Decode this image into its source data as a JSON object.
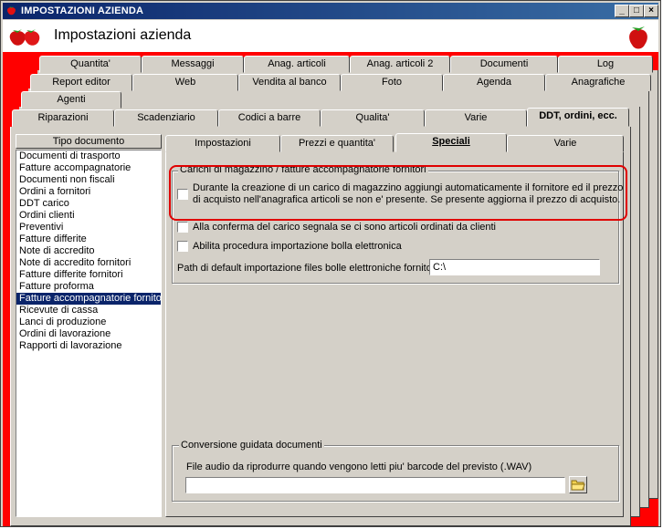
{
  "window": {
    "title": "IMPOSTAZIONI AZIENDA",
    "buttons": {
      "minimize": "_",
      "maximize": "□",
      "close": "×"
    }
  },
  "header": {
    "title": "Impostazioni azienda"
  },
  "tabs": {
    "row1": [
      "Quantita'",
      "Messaggi",
      "Anag. articoli",
      "Anag. articoli 2",
      "Documenti",
      "Log"
    ],
    "row2": [
      "Report editor",
      "Web",
      "Vendita al banco",
      "Foto",
      "Agenda",
      "Anagrafiche"
    ],
    "row3": [
      "Agenti"
    ],
    "row4": [
      "Riparazioni",
      "Scadenziario",
      "Codici a barre",
      "Qualita'",
      "Varie",
      "DDT, ordini, ecc."
    ]
  },
  "doc_list": {
    "header": "Tipo documento",
    "items": [
      "Documenti di trasporto",
      "Fatture accompagnatorie",
      "Documenti non fiscali",
      "Ordini a fornitori",
      "DDT carico",
      "Ordini clienti",
      "Preventivi",
      "Fatture differite",
      "Note di accredito",
      "Note di accredito fornitori",
      "Fatture differite fornitori",
      "Fatture proforma",
      "Fatture accompagnatorie fornitori",
      "Ricevute di cassa",
      "Lanci di produzione",
      "Ordini di lavorazione",
      "Rapporti di lavorazione"
    ],
    "selected": "Fatture accompagnatorie fornitori"
  },
  "subtabs": [
    "Impostazioni",
    "Prezzi e quantita'",
    "Speciali",
    "Varie"
  ],
  "active_subtab": "Speciali",
  "speciali": {
    "group1_title": "Carichi di magazzino / fatture accompagnatorie fornitori",
    "opt1_line1": "Durante la creazione di un carico di magazzino aggiungi automaticamente il fornitore ed il prezzo",
    "opt1_line2": "di acquisto nell'anagrafica articoli se non e' presente. Se presente aggiorna il prezzo di acquisto.",
    "opt2": "Alla conferma del carico segnala se ci sono articoli ordinati da clienti",
    "opt3": "Abilita procedura importazione bolla elettronica",
    "path_label": "Path di default importazione files bolle elettroniche fornitori",
    "path_value": "C:\\",
    "group2_title": "Conversione guidata documenti",
    "audio_label": "File audio da riprodurre quando vengono letti piu' barcode del previsto  (.WAV)",
    "audio_value": ""
  },
  "colors": {
    "titlebar": "#0a246a",
    "background": "#ff0000",
    "face": "#d4d0c8",
    "selection": "#0a246a",
    "highlight_ring": "#e00000"
  }
}
